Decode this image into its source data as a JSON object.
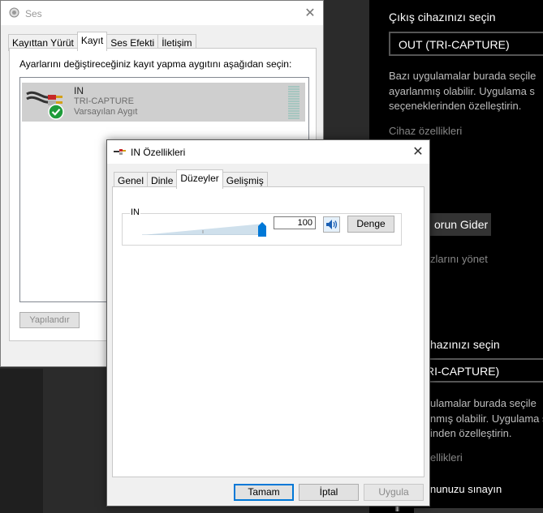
{
  "settings_panel": {
    "output_heading": "Çıkış cihazınızı seçin",
    "output_device": "OUT (TRI-CAPTURE)",
    "desc_line1": "Bazı uygulamalar burada seçile",
    "desc_line2": "ayarlanmış olabilir. Uygulama s",
    "desc_line3": "seçeneklerinden özelleştirin.",
    "device_props_link": "Cihaz özellikleri",
    "troubleshoot_button": "orun Gider",
    "manage_link": "zlarını yönet",
    "input_heading": "hazınızı seçin",
    "input_device": "RI-CAPTURE)",
    "desc2_line1": "ulamalar burada seçile",
    "desc2_line2": "nmış olabilir. Uygulama s",
    "desc2_line3": "inden özelleştirin.",
    "device_props_link2": "ellikleri",
    "test_heading": "nunuzu sınayın"
  },
  "ses_window": {
    "title": "Ses",
    "close_glyph": "✕",
    "tabs": [
      "Kayıttan Yürüt",
      "Kayıt",
      "Ses Efekti",
      "İletişim"
    ],
    "active_tab": "Kayıt",
    "instruction": "Ayarlarını değiştireceğiniz kayıt yapma aygıtını aşağıdan seçin:",
    "device": {
      "name": "IN",
      "subtitle": "TRI-CAPTURE",
      "status": "Varsayılan Aygıt"
    },
    "configure_button": "Yapılandır"
  },
  "properties_dialog": {
    "title": "IN Özellikleri",
    "close_glyph": "✕",
    "tabs": [
      "Genel",
      "Dinle",
      "Düzeyler",
      "Gelişmiş"
    ],
    "active_tab": "Düzeyler",
    "level_group_label": "IN",
    "level_value": "100",
    "level_fraction": 1.0,
    "balance_button": "Denge",
    "ok_button": "Tamam",
    "cancel_button": "İptal",
    "apply_button": "Uygula"
  },
  "colors": {
    "accent": "#0078d7",
    "check_green": "#1e9c3a",
    "settings_bg": "#000000"
  }
}
